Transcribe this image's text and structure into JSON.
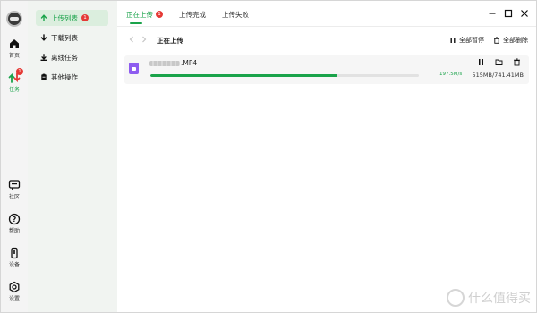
{
  "rail": {
    "items": [
      {
        "label": "首页",
        "icon": "home-icon"
      },
      {
        "label": "任务",
        "icon": "transfer-icon",
        "badge": "1"
      },
      {
        "label": "社区",
        "icon": "chat-icon"
      },
      {
        "label": "帮助",
        "icon": "help-icon"
      },
      {
        "label": "设备",
        "icon": "device-icon"
      },
      {
        "label": "设置",
        "icon": "settings-icon"
      }
    ]
  },
  "sidebar": {
    "items": [
      {
        "label": "上传列表",
        "icon": "upload-arrow-icon",
        "badge": "1"
      },
      {
        "label": "下载列表",
        "icon": "download-arrow-icon"
      },
      {
        "label": "离线任务",
        "icon": "offline-download-icon"
      },
      {
        "label": "其他操作",
        "icon": "clipboard-icon"
      }
    ]
  },
  "tabs": [
    {
      "label": "正在上传",
      "badge": "1"
    },
    {
      "label": "上传完成"
    },
    {
      "label": "上传失败"
    }
  ],
  "subbar": {
    "title": "正在上传",
    "pause_all": "全部暂停",
    "delete_all": "全部删除"
  },
  "transfer": {
    "filename_suffix": ".MP4",
    "progress": 0.695,
    "speed": "197.5M/s",
    "size": "515MB/741.41MB"
  },
  "watermark": {
    "text": "什么值得买"
  },
  "colors": {
    "accent": "#1aa34a",
    "badge": "#e53935",
    "file_icon": "#8e5cf0"
  }
}
